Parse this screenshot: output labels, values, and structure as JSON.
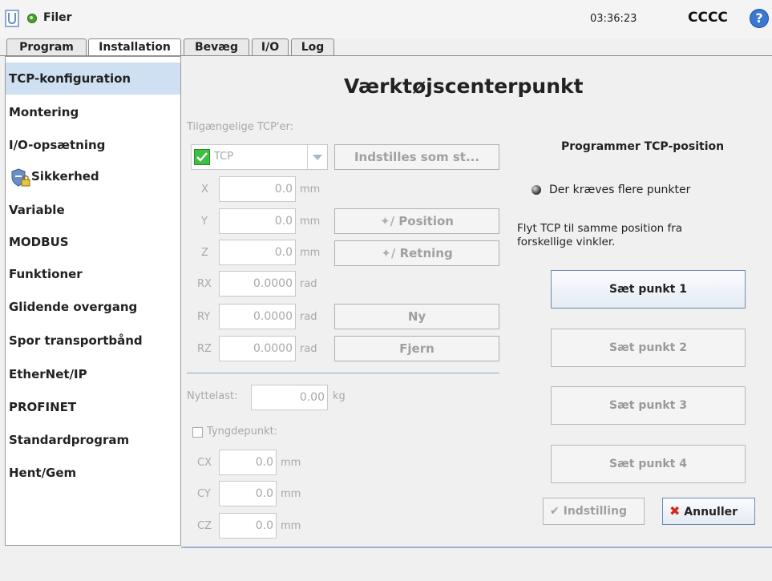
{
  "header": {
    "files_label": "Filer",
    "clock": "03:36:23",
    "robot_name": "CCCC",
    "help_icon": "?"
  },
  "tabs": [
    "Program",
    "Installation",
    "Bevæg",
    "I/O",
    "Log"
  ],
  "sidebar": {
    "items": [
      "TCP-konfiguration",
      "Montering",
      "I/O-opsætning",
      "Sikkerhed",
      "Variable",
      "MODBUS",
      "Funktioner",
      "Glidende overgang",
      "Spor transportbånd",
      "EtherNet/IP",
      "PROFINET",
      "Standardprogram",
      "Hent/Gem"
    ]
  },
  "main": {
    "title": "Værktøjscenterpunkt",
    "available_label": "Tilgængelige TCP'er:",
    "tcp_select": "TCP",
    "set_default_button": "Indstilles som st...",
    "coords": [
      {
        "label": "X",
        "value": "0.0",
        "unit": "mm"
      },
      {
        "label": "Y",
        "value": "0.0",
        "unit": "mm"
      },
      {
        "label": "Z",
        "value": "0.0",
        "unit": "mm"
      },
      {
        "label": "RX",
        "value": "0.0000",
        "unit": "rad"
      },
      {
        "label": "RY",
        "value": "0.0000",
        "unit": "rad"
      },
      {
        "label": "RZ",
        "value": "0.0000",
        "unit": "rad"
      }
    ],
    "position_button": "Position",
    "orientation_button": "Retning",
    "new_button": "Ny",
    "remove_button": "Fjern",
    "payload_label": "Nyttelast:",
    "payload_value": "0.00",
    "payload_unit": "kg",
    "cog_label": "Tyngdepunkt:",
    "cog": [
      {
        "label": "CX",
        "value": "0.0",
        "unit": "mm"
      },
      {
        "label": "CY",
        "value": "0.0",
        "unit": "mm"
      },
      {
        "label": "CZ",
        "value": "0.0",
        "unit": "mm"
      }
    ]
  },
  "teach": {
    "title": "Programmer TCP-position",
    "status": "Der kræves flere punkter",
    "instruction_line1": "Flyt TCP til samme position fra",
    "instruction_line2": "forskellige vinkler.",
    "points": [
      "Sæt punkt 1",
      "Sæt punkt 2",
      "Sæt punkt 3",
      "Sæt punkt 4"
    ],
    "apply_button": "Indstilling",
    "cancel_button": "Annuller"
  },
  "colors": {
    "accent": "#3a78d4",
    "selected_bg": "#cfe0f3",
    "status_green": "#4aa02c"
  }
}
